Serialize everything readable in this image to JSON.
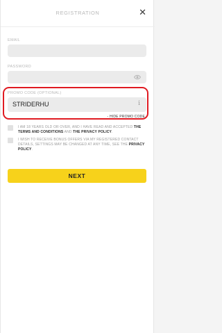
{
  "header": {
    "title": "REGISTRATION",
    "close_icon": "close-icon"
  },
  "form": {
    "email_label": "EMAIL",
    "email_value": "",
    "password_label": "PASSWORD",
    "password_value": "",
    "password_toggle_icon": "eye-icon",
    "promo_label": "PROMO CODE (OPTIONAL)",
    "promo_value": "STRIDERHU",
    "promo_info_icon": "info-icon",
    "hide_promo": "- HIDE PROMO CODE"
  },
  "consents": {
    "age_text_1": "I AM 18 YEARS OLD OR OVER, AND I HAVE READ AND ACCEPTED ",
    "terms_link": "THE TERMS AND CONDITIONS",
    "and_text": " AND ",
    "privacy_link": "THE PRIVACY POLICY",
    "age_text_end": ".",
    "offers_text": "I WISH TO RECEIVE BONUS OFFERS VIA MY REGISTERED CONTACT DETAILS, SETTINGS MAY BE CHANGED AT ANY TIME, SEE THE ",
    "offers_privacy_link": "PRIVACY POLICY",
    "offers_text_end": "."
  },
  "actions": {
    "next_label": "NEXT"
  },
  "colors": {
    "accent": "#f7d21b",
    "highlight": "#e01b22"
  }
}
